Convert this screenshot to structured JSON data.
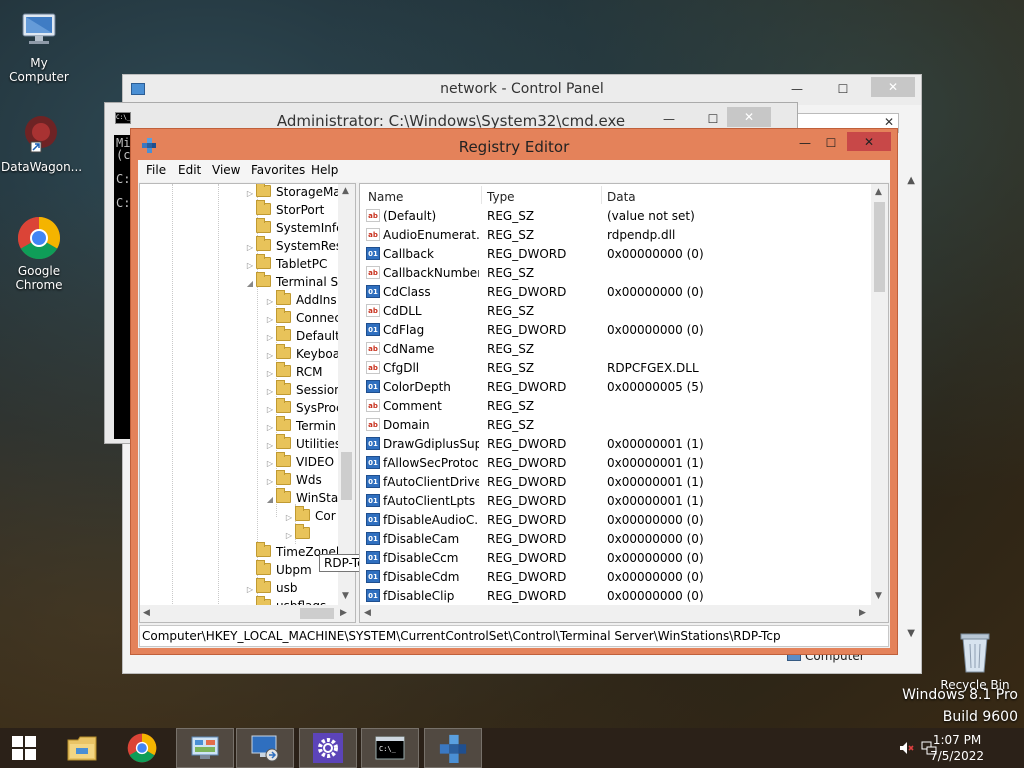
{
  "desktop": {
    "icons": [
      {
        "label": "My Computer",
        "icon": "computer-icon"
      },
      {
        "label": "DataWagon...",
        "icon": "datawagon-shortcut-icon"
      },
      {
        "label": "Google Chrome",
        "icon": "chrome-icon"
      },
      {
        "label": "Recycle Bin",
        "icon": "recycle-bin-icon"
      }
    ],
    "watermark": {
      "line1": "Windows 8.1 Pro",
      "line2": "Build 9600"
    }
  },
  "control_panel": {
    "title": "network - Control Panel",
    "controls": {
      "minimize": "—",
      "maximize": "☐",
      "close": "✕"
    },
    "search_clear": "✕",
    "bottom_label": "Computer"
  },
  "cmd": {
    "title": "Administrator: C:\\Windows\\System32\\cmd.exe",
    "icon_text": "C:\\_",
    "console_lines": [
      "Mi",
      "(c",
      "",
      "C:",
      "",
      "C:"
    ],
    "controls": {
      "minimize": "—",
      "maximize": "☐",
      "close": "✕"
    }
  },
  "regedit": {
    "title": "Registry Editor",
    "controls": {
      "minimize": "—",
      "maximize": "☐",
      "close": "✕"
    },
    "menu": [
      "File",
      "Edit",
      "View",
      "Favorites",
      "Help"
    ],
    "tree": [
      {
        "label": "StorageMa",
        "level": 0,
        "expander": "▷"
      },
      {
        "label": "StorPort",
        "level": 0,
        "expander": ""
      },
      {
        "label": "SystemInfc",
        "level": 0,
        "expander": ""
      },
      {
        "label": "SystemRes",
        "level": 0,
        "expander": "▷"
      },
      {
        "label": "TabletPC",
        "level": 0,
        "expander": "▷"
      },
      {
        "label": "Terminal S",
        "level": 0,
        "expander": "◢"
      },
      {
        "label": "AddIns",
        "level": 1,
        "expander": "▷"
      },
      {
        "label": "Connec",
        "level": 1,
        "expander": "▷"
      },
      {
        "label": "Default",
        "level": 1,
        "expander": "▷"
      },
      {
        "label": "Keyboa",
        "level": 1,
        "expander": "▷"
      },
      {
        "label": "RCM",
        "level": 1,
        "expander": "▷"
      },
      {
        "label": "Session",
        "level": 1,
        "expander": "▷"
      },
      {
        "label": "SysProc",
        "level": 1,
        "expander": "▷"
      },
      {
        "label": "Termin",
        "level": 1,
        "expander": "▷"
      },
      {
        "label": "Utilities",
        "level": 1,
        "expander": "▷"
      },
      {
        "label": "VIDEO",
        "level": 1,
        "expander": "▷"
      },
      {
        "label": "Wds",
        "level": 1,
        "expander": "▷"
      },
      {
        "label": "WinSta",
        "level": 1,
        "expander": "◢"
      },
      {
        "label": "Cor",
        "level": 2,
        "expander": "▷"
      },
      {
        "label": "",
        "level": 2,
        "expander": "▷"
      },
      {
        "label": "TimeZonel",
        "level": 0,
        "expander": ""
      },
      {
        "label": "Ubpm",
        "level": 0,
        "expander": ""
      },
      {
        "label": "usb",
        "level": 0,
        "expander": "▷"
      },
      {
        "label": "usbflags",
        "level": 0,
        "expander": "▷"
      }
    ],
    "tooltip": "RDP-Tcp",
    "columns": {
      "name": "Name",
      "type": "Type",
      "data": "Data"
    },
    "values": [
      {
        "icon": "ab",
        "name": "(Default)",
        "type": "REG_SZ",
        "data": "(value not set)"
      },
      {
        "icon": "ab",
        "name": "AudioEnumerat...",
        "type": "REG_SZ",
        "data": "rdpendp.dll"
      },
      {
        "icon": "01",
        "name": "Callback",
        "type": "REG_DWORD",
        "data": "0x00000000 (0)"
      },
      {
        "icon": "ab",
        "name": "CallbackNumber",
        "type": "REG_SZ",
        "data": ""
      },
      {
        "icon": "01",
        "name": "CdClass",
        "type": "REG_DWORD",
        "data": "0x00000000 (0)"
      },
      {
        "icon": "ab",
        "name": "CdDLL",
        "type": "REG_SZ",
        "data": ""
      },
      {
        "icon": "01",
        "name": "CdFlag",
        "type": "REG_DWORD",
        "data": "0x00000000 (0)"
      },
      {
        "icon": "ab",
        "name": "CdName",
        "type": "REG_SZ",
        "data": ""
      },
      {
        "icon": "ab",
        "name": "CfgDll",
        "type": "REG_SZ",
        "data": "RDPCFGEX.DLL"
      },
      {
        "icon": "01",
        "name": "ColorDepth",
        "type": "REG_DWORD",
        "data": "0x00000005 (5)"
      },
      {
        "icon": "ab",
        "name": "Comment",
        "type": "REG_SZ",
        "data": ""
      },
      {
        "icon": "ab",
        "name": "Domain",
        "type": "REG_SZ",
        "data": ""
      },
      {
        "icon": "01",
        "name": "DrawGdiplusSup...",
        "type": "REG_DWORD",
        "data": "0x00000001 (1)"
      },
      {
        "icon": "01",
        "name": "fAllowSecProtoc...",
        "type": "REG_DWORD",
        "data": "0x00000001 (1)"
      },
      {
        "icon": "01",
        "name": "fAutoClientDrives",
        "type": "REG_DWORD",
        "data": "0x00000001 (1)"
      },
      {
        "icon": "01",
        "name": "fAutoClientLpts",
        "type": "REG_DWORD",
        "data": "0x00000001 (1)"
      },
      {
        "icon": "01",
        "name": "fDisableAudioC...",
        "type": "REG_DWORD",
        "data": "0x00000000 (0)"
      },
      {
        "icon": "01",
        "name": "fDisableCam",
        "type": "REG_DWORD",
        "data": "0x00000000 (0)"
      },
      {
        "icon": "01",
        "name": "fDisableCcm",
        "type": "REG_DWORD",
        "data": "0x00000000 (0)"
      },
      {
        "icon": "01",
        "name": "fDisableCdm",
        "type": "REG_DWORD",
        "data": "0x00000000 (0)"
      },
      {
        "icon": "01",
        "name": "fDisableClip",
        "type": "REG_DWORD",
        "data": "0x00000000 (0)"
      }
    ],
    "status_path": "Computer\\HKEY_LOCAL_MACHINE\\SYSTEM\\CurrentControlSet\\Control\\Terminal Server\\WinStations\\RDP-Tcp"
  },
  "taskbar": {
    "items": [
      {
        "name": "file-explorer",
        "icon": "folder-icon"
      },
      {
        "name": "chrome",
        "icon": "chrome-icon"
      },
      {
        "name": "control-panel",
        "icon": "control-panel-icon"
      },
      {
        "name": "remote-desktop",
        "icon": "remote-desktop-icon"
      },
      {
        "name": "settings",
        "icon": "gear-icon"
      },
      {
        "name": "cmd",
        "icon": "console-icon"
      },
      {
        "name": "regedit",
        "icon": "regedit-icon"
      }
    ],
    "active_item": "regedit",
    "clock": {
      "time": "1:07 PM",
      "date": "7/5/2022"
    }
  },
  "colors": {
    "regedit_frame": "#e4825a",
    "close_button": "#c84848",
    "taskbar": "#2b2118"
  }
}
